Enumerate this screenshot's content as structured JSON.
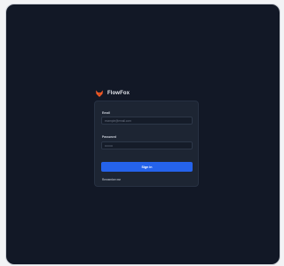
{
  "brand": {
    "name": "FlowFox",
    "logo_icon": "fox-logo-icon",
    "logo_color": "#f05a28"
  },
  "form": {
    "email_label": "Email",
    "email_placeholder": "example@email.com",
    "password_label": "Password",
    "password_placeholder": "••••••••",
    "submit_label": "Sign in",
    "remember_label": "Remember me"
  },
  "colors": {
    "background": "#121826",
    "card": "#1d2533",
    "accent": "#2563eb"
  }
}
